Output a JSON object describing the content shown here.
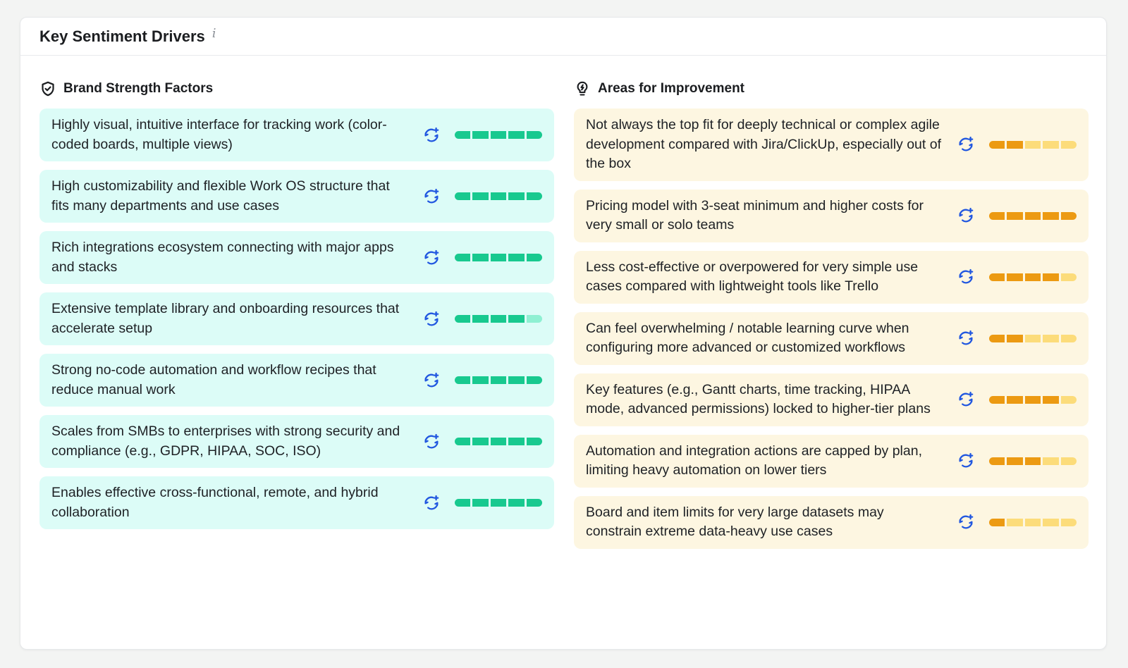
{
  "header": {
    "title": "Key Sentiment Drivers",
    "info_glyph": "i"
  },
  "colors": {
    "strength_fill": "#18c98f",
    "strength_empty": "#8ef0d2",
    "improve_fill": "#ec9a12",
    "improve_empty": "#fcdc7a",
    "icon_blue": "#2157e0"
  },
  "strengths": {
    "title": "Brand Strength Factors",
    "icon": "shield-check-icon",
    "items": [
      {
        "text": "Highly visual, intuitive interface for tracking work (color-coded boards, multiple views)",
        "score": 5
      },
      {
        "text": "High customizability and flexible Work OS structure that fits many departments and use cases",
        "score": 5
      },
      {
        "text": "Rich integrations ecosystem connecting with major apps and stacks",
        "score": 5
      },
      {
        "text": "Extensive template library and onboarding resources that accelerate setup",
        "score": 4
      },
      {
        "text": "Strong no-code automation and workflow recipes that reduce manual work",
        "score": 5
      },
      {
        "text": "Scales from SMBs to enterprises with strong security and compliance (e.g., GDPR, HIPAA, SOC, ISO)",
        "score": 5
      },
      {
        "text": "Enables effective cross-functional, remote, and hybrid collaboration",
        "score": 5
      }
    ]
  },
  "improvements": {
    "title": "Areas for Improvement",
    "icon": "lightbulb-icon",
    "items": [
      {
        "text": "Not always the top fit for deeply technical or complex agile development compared with Jira/ClickUp, especially out of the box",
        "score": 2
      },
      {
        "text": "Pricing model with 3-seat minimum and higher costs for very small or solo teams",
        "score": 5
      },
      {
        "text": "Less cost-effective or overpowered for very simple use cases compared with lightweight tools like Trello",
        "score": 4
      },
      {
        "text": "Can feel overwhelming / notable learning curve when configuring more advanced or customized workflows",
        "score": 2
      },
      {
        "text": "Key features (e.g., Gantt charts, time tracking, HIPAA mode, advanced permissions) locked to higher-tier plans",
        "score": 4
      },
      {
        "text": "Automation and integration actions are capped by plan, limiting heavy automation on lower tiers",
        "score": 3
      },
      {
        "text": "Board and item limits for very large datasets may constrain extreme data-heavy use cases",
        "score": 1
      }
    ]
  },
  "max_score": 5
}
